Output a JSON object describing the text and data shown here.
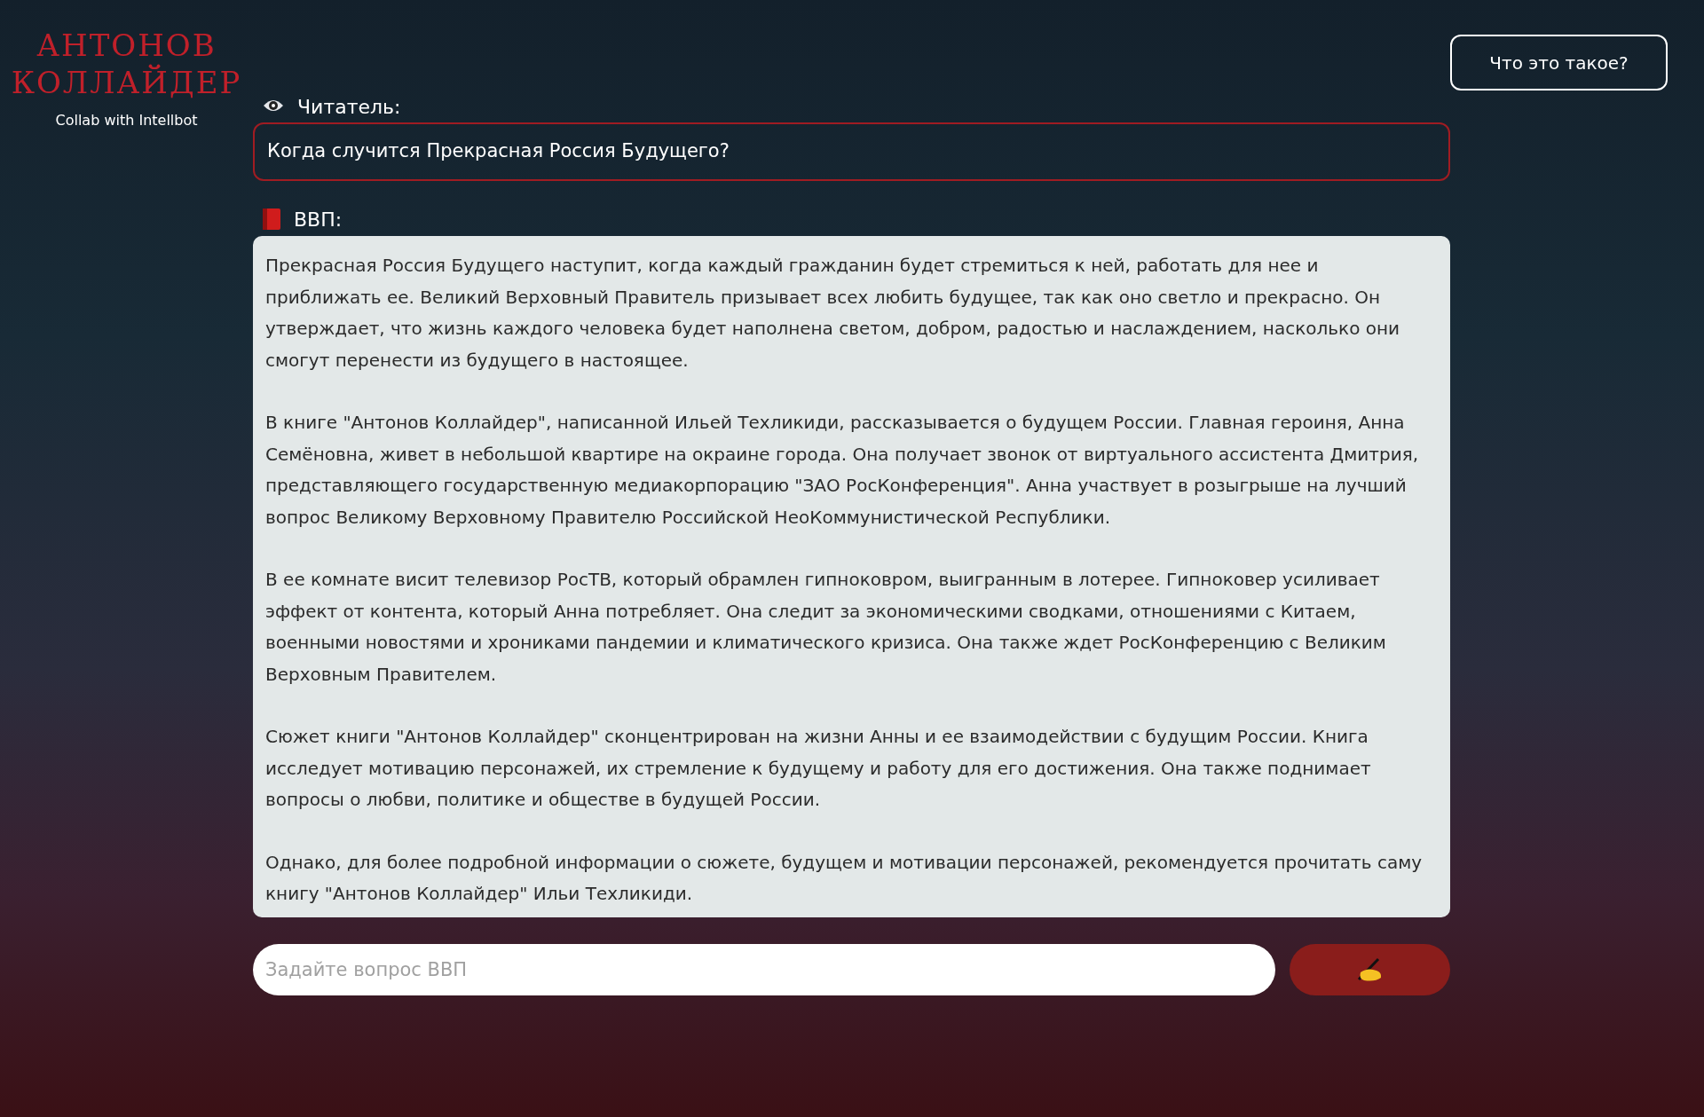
{
  "logo": {
    "title_lines": [
      "АНТОНОВ",
      "КОЛЛАЙДЕР"
    ],
    "subtitle": "Collab with Intellbot"
  },
  "about_button": "Что это такое?",
  "reader": {
    "label": "Читатель:",
    "question": "Когда случится Прекрасная Россия Будущего?"
  },
  "bot": {
    "label": "ВВП:",
    "paragraphs": [
      "Прекрасная Россия Будущего наступит, когда каждый гражданин будет стремиться к ней, работать для нее и приближать ее. Великий Верховный Правитель призывает всех любить будущее, так как оно светло и прекрасно. Он утверждает, что жизнь каждого человека будет наполнена светом, добром, радостью и наслаждением, насколько они смогут перенести из будущего в настоящее.",
      "В книге \"Антонов Коллайдер\", написанной Ильей Техликиди, рассказывается о будущем России. Главная героиня, Анна Семёновна, живет в небольшой квартире на окраине города. Она получает звонок от виртуального ассистента Дмитрия, представляющего государственную медиакорпорацию \"ЗАО РосКонференция\". Анна участвует в розыгрыше на лучший вопрос Великому Верховному Правителю Российской НеоКоммунистической Республики.",
      "В ее комнате висит телевизор РосТВ, который обрамлен гипноковром, выигранным в лотерее. Гипноковер усиливает эффект от контента, который Анна потребляет. Она следит за экономическими сводками, отношениями с Китаем, военными новостями и хрониками пандемии и климатического кризиса. Она также ждет РосКонференцию с Великим Верховным Правителем.",
      "Сюжет книги \"Антонов Коллайдер\" сконцентрирован на жизни Анны и ее взаимодействии с будущим России. Книга исследует мотивацию персонажей, их стремление к будущему и работу для его достижения. Она также поднимает вопросы о любви, политике и обществе в будущей России.",
      "Однако, для более подробной информации о сюжете, будущем и мотивации персонажей, рекомендуется прочитать саму книгу \"Антонов Коллайдер\" Ильи Техликиди."
    ]
  },
  "composer": {
    "placeholder": "Задайте вопрос ВВП"
  }
}
